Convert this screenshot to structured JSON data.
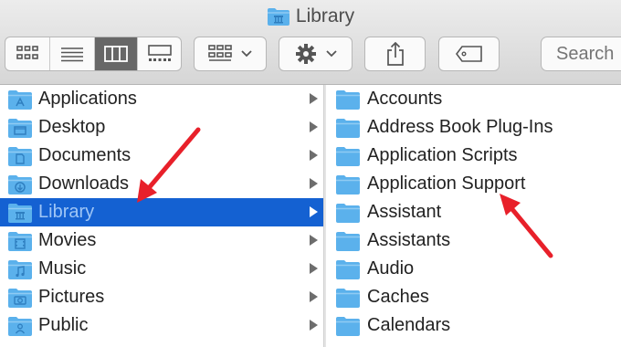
{
  "window": {
    "title": "Library"
  },
  "toolbar": {
    "view_modes": [
      "icon-view",
      "list-view",
      "column-view",
      "gallery-view"
    ],
    "active_view": "column-view",
    "search_placeholder": "Search"
  },
  "sidebar_column": {
    "items": [
      {
        "label": "Applications",
        "icon": "applications-folder-icon",
        "selected": false
      },
      {
        "label": "Desktop",
        "icon": "desktop-folder-icon",
        "selected": false
      },
      {
        "label": "Documents",
        "icon": "documents-folder-icon",
        "selected": false
      },
      {
        "label": "Downloads",
        "icon": "downloads-folder-icon",
        "selected": false
      },
      {
        "label": "Library",
        "icon": "library-folder-icon",
        "selected": true
      },
      {
        "label": "Movies",
        "icon": "movies-folder-icon",
        "selected": false
      },
      {
        "label": "Music",
        "icon": "music-folder-icon",
        "selected": false
      },
      {
        "label": "Pictures",
        "icon": "pictures-folder-icon",
        "selected": false
      },
      {
        "label": "Public",
        "icon": "public-folder-icon",
        "selected": false
      }
    ]
  },
  "content_column": {
    "items": [
      {
        "label": "Accounts"
      },
      {
        "label": "Address Book Plug-Ins"
      },
      {
        "label": "Application Scripts"
      },
      {
        "label": "Application Support"
      },
      {
        "label": "Assistant"
      },
      {
        "label": "Assistants"
      },
      {
        "label": "Audio"
      },
      {
        "label": "Caches"
      },
      {
        "label": "Calendars"
      }
    ]
  },
  "colors": {
    "folder": "#5bb1ec",
    "selection": "#1461d2",
    "annotation_arrow": "#e8202a"
  }
}
